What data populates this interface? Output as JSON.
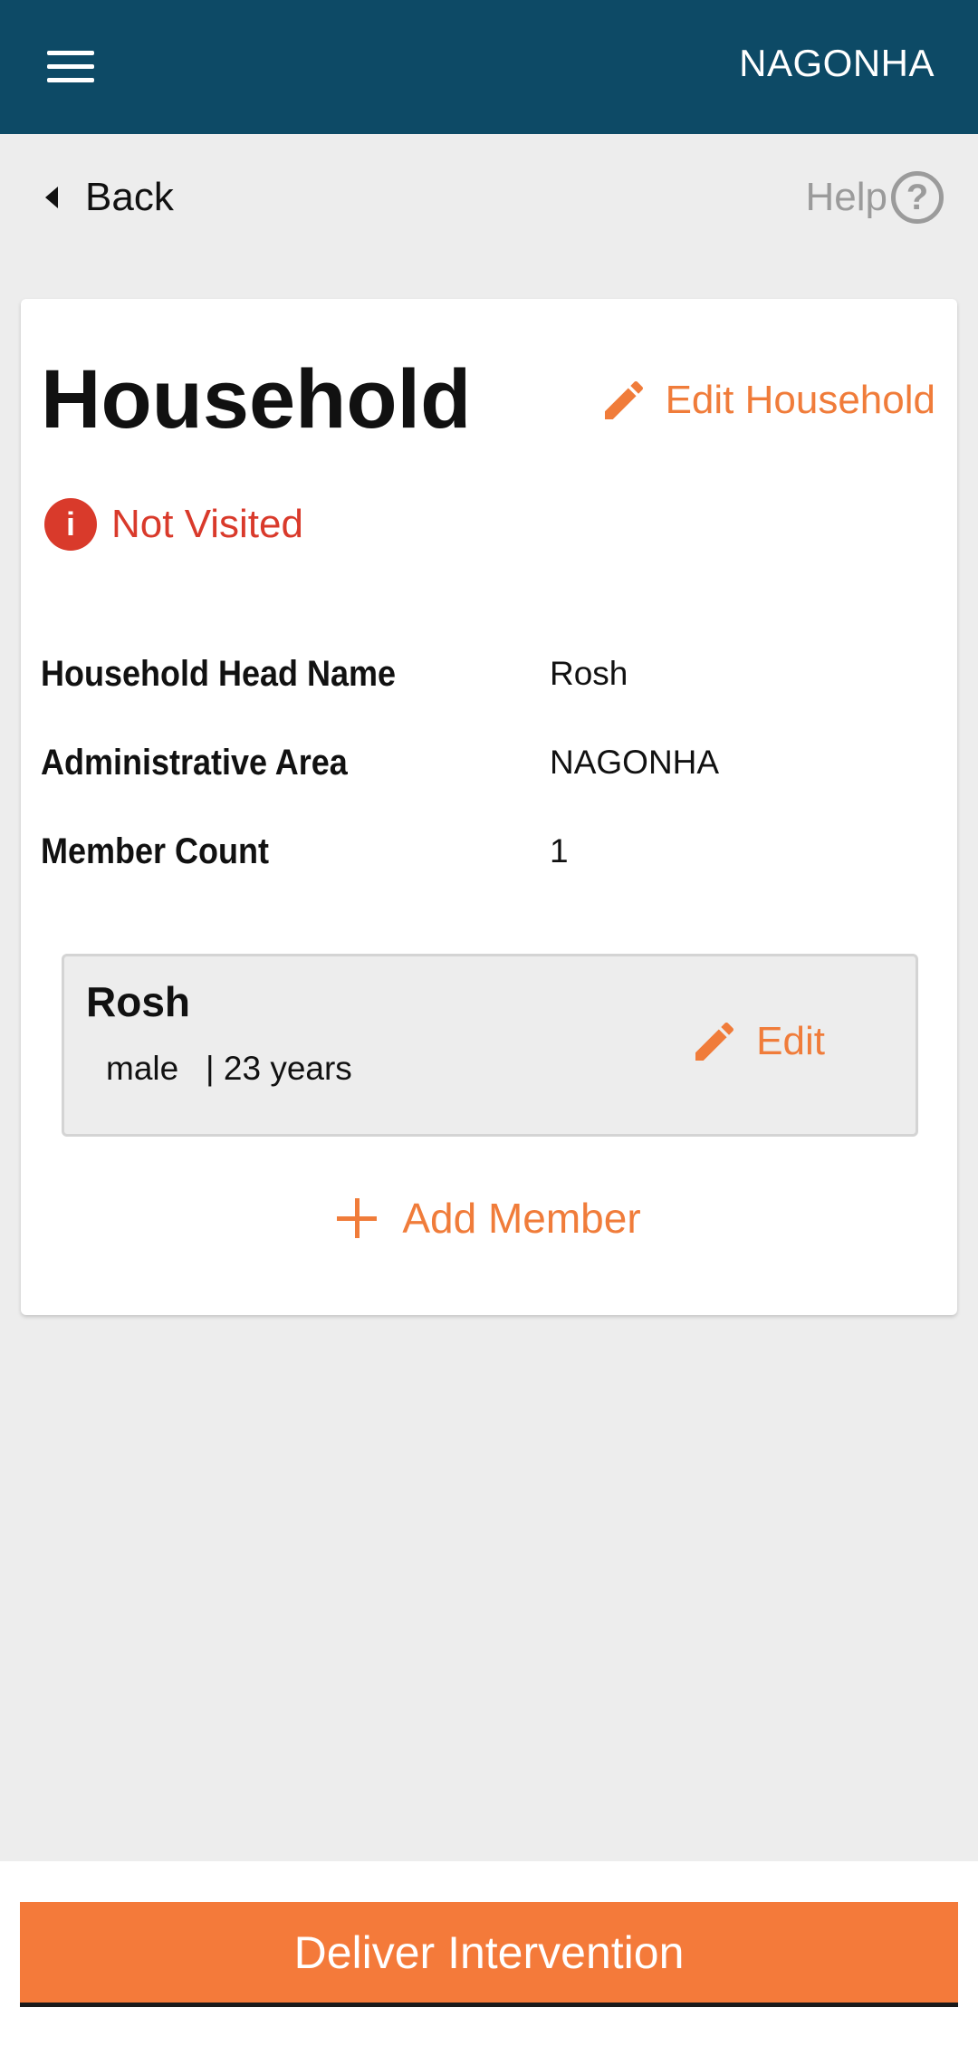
{
  "appbar": {
    "title": "NAGONHA",
    "menu_icon": "hamburger-menu-icon"
  },
  "nav": {
    "back_label": "Back",
    "help_label": "Help",
    "help_icon": "?"
  },
  "household": {
    "title": "Household",
    "edit_label": "Edit Household",
    "status": {
      "label": "Not Visited",
      "icon_text": "i",
      "color": "#d93a2b"
    },
    "details": [
      {
        "label": "Household Head Name",
        "value": "Rosh"
      },
      {
        "label": "Administrative Area",
        "value": "NAGONHA"
      },
      {
        "label": "Member Count",
        "value": "1"
      }
    ],
    "members": [
      {
        "name": "Rosh",
        "gender": "male",
        "age": "| 23 years",
        "edit_label": "Edit"
      }
    ],
    "add_member_label": "Add Member"
  },
  "footer": {
    "deliver_label": "Deliver Intervention"
  },
  "colors": {
    "primary": "#0d4a66",
    "accent": "#f07c3a",
    "button": "#f47a3a",
    "background": "#ededed"
  }
}
